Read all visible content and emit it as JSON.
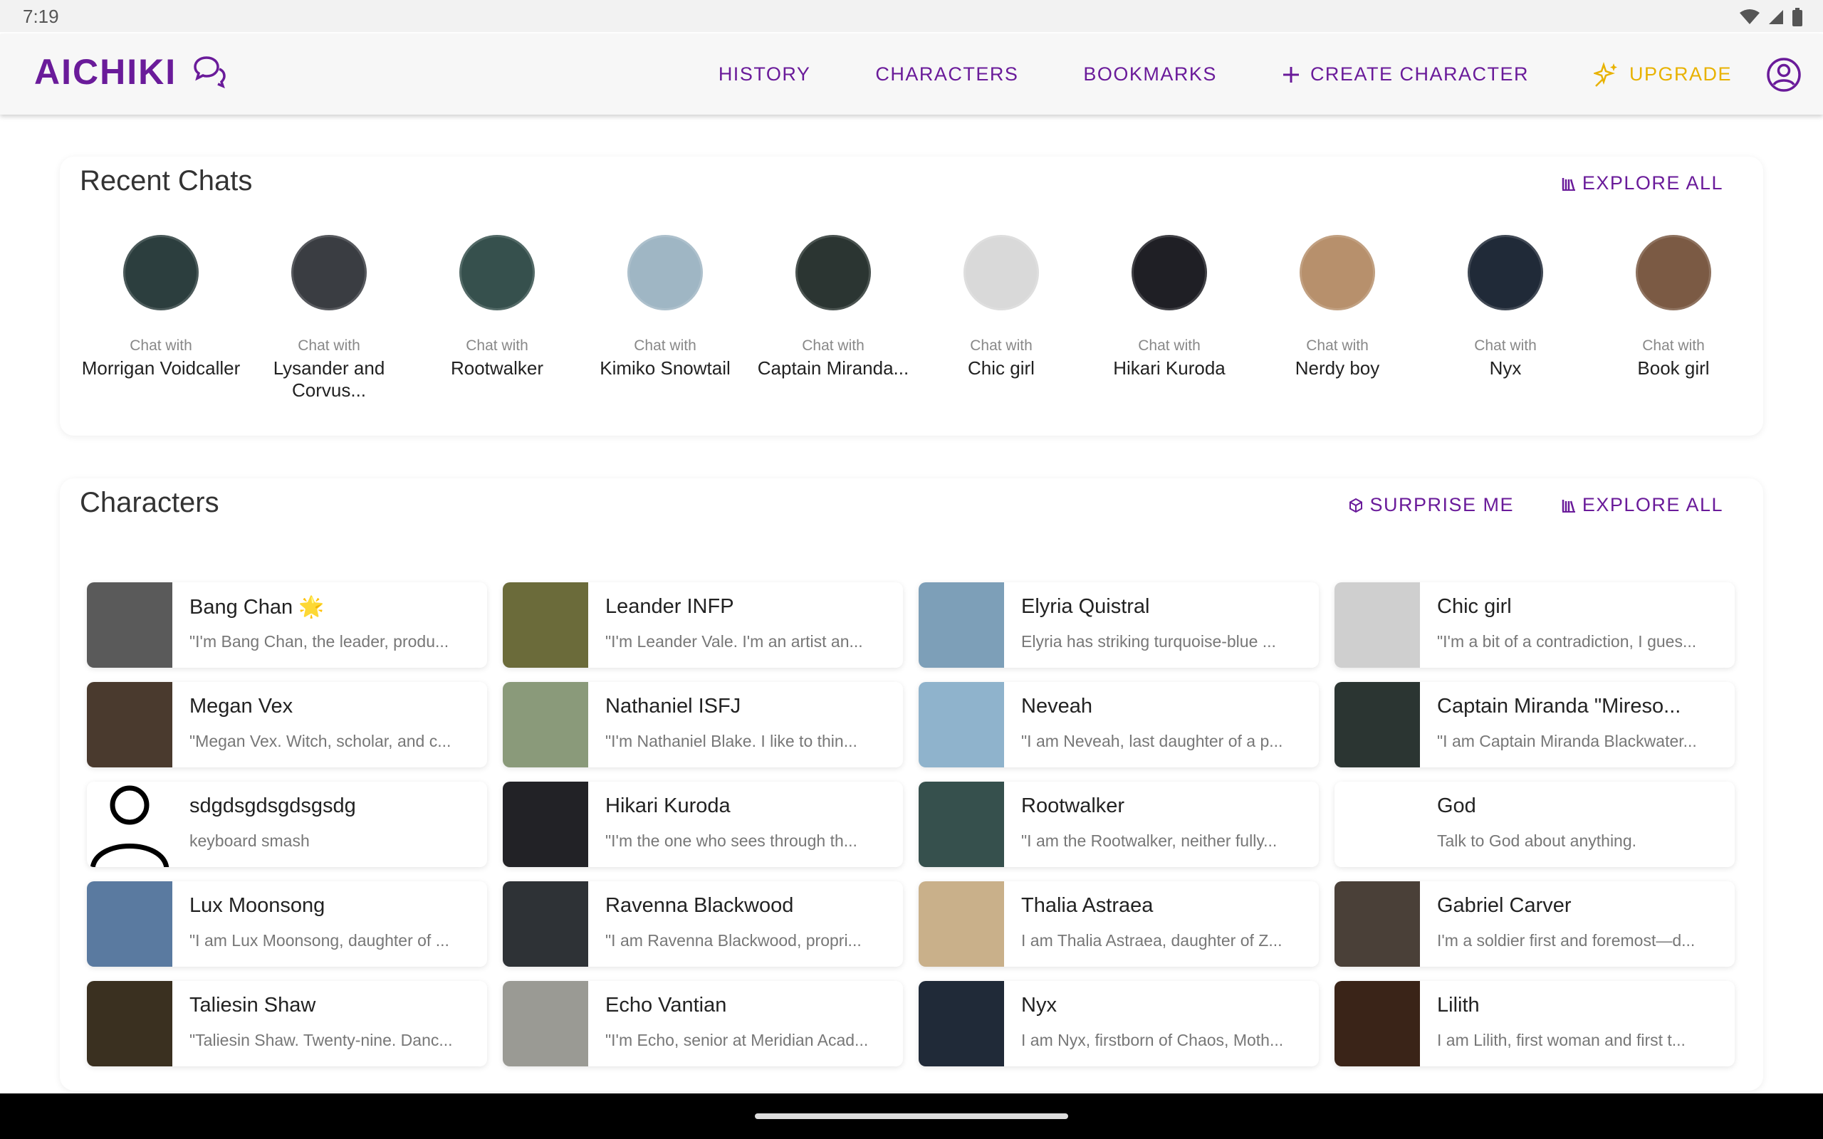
{
  "status": {
    "time": "7:19"
  },
  "app": {
    "name": "AICHIKI"
  },
  "nav": {
    "history": "HISTORY",
    "characters": "CHARACTERS",
    "bookmarks": "BOOKMARKS",
    "create": "CREATE CHARACTER",
    "upgrade": "UPGRADE"
  },
  "recent": {
    "title": "Recent Chats",
    "explore_all": "EXPLORE ALL",
    "items": [
      {
        "prefix": "Chat with",
        "name": "Morrigan Voidcaller",
        "color": "#2c3e3e"
      },
      {
        "prefix": "Chat with",
        "name": "Lysander and Corvus...",
        "color": "#3a3d42"
      },
      {
        "prefix": "Chat with",
        "name": "Rootwalker",
        "color": "#36504d"
      },
      {
        "prefix": "Chat with",
        "name": "Kimiko Snowtail",
        "color": "#9fb6c4"
      },
      {
        "prefix": "Chat with",
        "name": "Captain Miranda...",
        "color": "#2b3532"
      },
      {
        "prefix": "Chat with",
        "name": "Chic girl",
        "color": "#d9d9d9"
      },
      {
        "prefix": "Chat with",
        "name": "Hikari Kuroda",
        "color": "#1f1f25"
      },
      {
        "prefix": "Chat with",
        "name": "Nerdy boy",
        "color": "#b7906c"
      },
      {
        "prefix": "Chat with",
        "name": "Nyx",
        "color": "#202a38"
      },
      {
        "prefix": "Chat with",
        "name": "Book girl",
        "color": "#7b5a44"
      }
    ]
  },
  "characters": {
    "title": "Characters",
    "surprise": "SURPRISE ME",
    "explore_all": "EXPLORE ALL",
    "items": [
      {
        "name": "Bang Chan 🌟",
        "desc": "\"I'm Bang Chan, the leader, produ...",
        "color": "#5a5a5a"
      },
      {
        "name": "Leander INFP",
        "desc": "\"I'm Leander Vale. I'm an artist an...",
        "color": "#6b6b3a"
      },
      {
        "name": "Elyria Quistral",
        "desc": "Elyria has striking turquoise-blue ...",
        "color": "#7d9fb8"
      },
      {
        "name": "Chic girl",
        "desc": "\"I'm a bit of a contradiction, I gues...",
        "color": "#cfcfcf"
      },
      {
        "name": "Megan Vex",
        "desc": "\"Megan Vex. Witch, scholar, and c...",
        "color": "#4a3a2e"
      },
      {
        "name": "Nathaniel ISFJ",
        "desc": "\"I'm Nathaniel Blake. I like to thin...",
        "color": "#8a9a7a"
      },
      {
        "name": "Neveah",
        "desc": "\"I am Neveah, last daughter of a p...",
        "color": "#8fb3cc"
      },
      {
        "name": "Captain Miranda \"Mireso...",
        "desc": "\"I am Captain Miranda Blackwater...",
        "color": "#2b3532"
      },
      {
        "name": "sdgdsgdsgdsgsdg",
        "desc": "keyboard smash",
        "color": "#ffffff",
        "placeholder": true
      },
      {
        "name": "Hikari Kuroda",
        "desc": "\"I'm the one who sees through th...",
        "color": "#222226"
      },
      {
        "name": "Rootwalker",
        "desc": "\"I am the Rootwalker, neither fully...",
        "color": "#36504d"
      },
      {
        "name": "God",
        "desc": "Talk to God about anything.",
        "color": "#ffffff"
      },
      {
        "name": "Lux Moonsong",
        "desc": "\"I am Lux Moonsong, daughter of ...",
        "color": "#5a7aa0"
      },
      {
        "name": "Ravenna Blackwood",
        "desc": "\"I am Ravenna Blackwood, propri...",
        "color": "#2e3236"
      },
      {
        "name": "Thalia Astraea",
        "desc": "I am Thalia Astraea, daughter of Z...",
        "color": "#c9b08a"
      },
      {
        "name": "Gabriel Carver",
        "desc": "I'm a soldier first and foremost—d...",
        "color": "#4a4038"
      },
      {
        "name": "Taliesin Shaw",
        "desc": "\"Taliesin Shaw. Twenty-nine. Danc...",
        "color": "#3a3020"
      },
      {
        "name": "Echo Vantian",
        "desc": "\"I'm Echo, senior at Meridian Acad...",
        "color": "#9a9a94"
      },
      {
        "name": "Nyx",
        "desc": "I am Nyx, firstborn of Chaos, Moth...",
        "color": "#202a38"
      },
      {
        "name": "Lilith",
        "desc": "I am Lilith, first woman and first t...",
        "color": "#3a2418"
      }
    ]
  }
}
